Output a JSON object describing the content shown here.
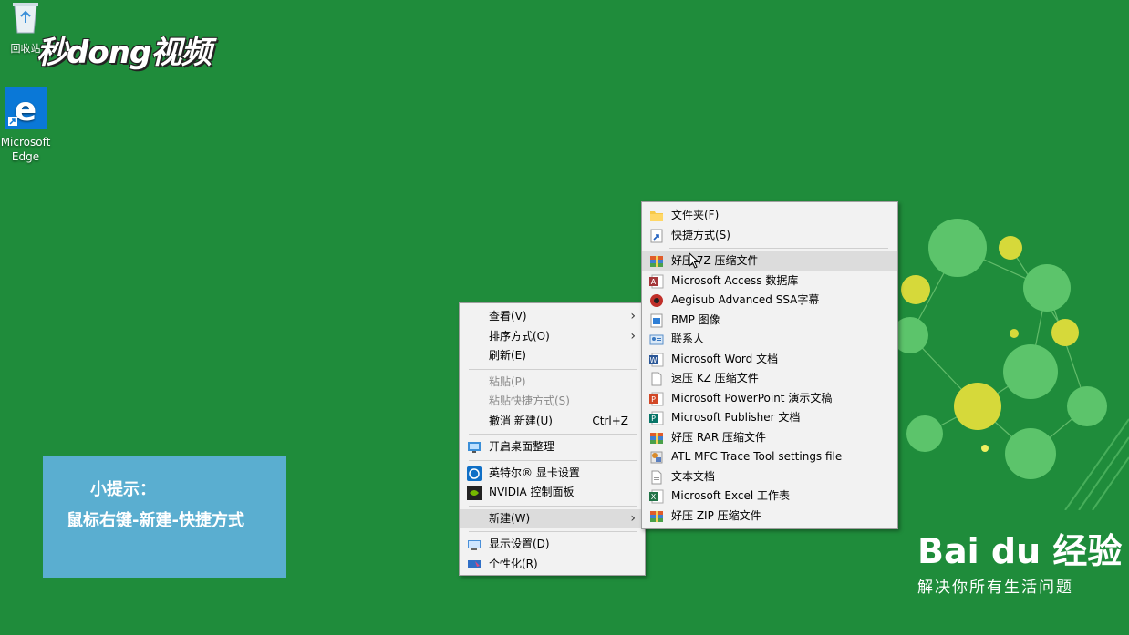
{
  "desktop": {
    "icons": [
      {
        "label": "回收站",
        "icon": "recycle-bin-icon"
      },
      {
        "label": "Microsoft Edge",
        "icon": "edge-icon"
      }
    ],
    "watermark": "秒dong视频"
  },
  "tip": {
    "title": "小提示：",
    "text": "鼠标右键-新建-快捷方式"
  },
  "baidu": {
    "brand": "Bai du 经验",
    "slogan": "解决你所有生活问题"
  },
  "context_menu": {
    "items": [
      {
        "label": "查看(V)",
        "submenu": true
      },
      {
        "label": "排序方式(O)",
        "submenu": true
      },
      {
        "label": "刷新(E)"
      },
      {
        "label": "粘贴(P)",
        "disabled": true
      },
      {
        "label": "粘贴快捷方式(S)",
        "disabled": true
      },
      {
        "label": "撤消 新建(U)",
        "shortcut": "Ctrl+Z"
      },
      {
        "label": "开启桌面整理",
        "icon": "desktop-organize-icon"
      },
      {
        "label": "英特尔® 显卡设置",
        "icon": "intel-graphics-icon"
      },
      {
        "label": "NVIDIA 控制面板",
        "icon": "nvidia-icon"
      },
      {
        "label": "新建(W)",
        "submenu": true,
        "highlighted": true
      },
      {
        "label": "显示设置(D)",
        "icon": "display-icon"
      },
      {
        "label": "个性化(R)",
        "icon": "personalize-icon"
      }
    ]
  },
  "new_submenu": {
    "items": [
      {
        "label": "文件夹(F)",
        "icon": "folder-icon"
      },
      {
        "label": "快捷方式(S)",
        "icon": "shortcut-icon"
      },
      {
        "label": "好压 7Z 压缩文件",
        "icon": "archive-icon",
        "highlighted": true
      },
      {
        "label": "Microsoft Access 数据库",
        "icon": "access-icon"
      },
      {
        "label": "Aegisub Advanced SSA字幕",
        "icon": "aegisub-icon"
      },
      {
        "label": "BMP 图像",
        "icon": "bmp-icon"
      },
      {
        "label": "联系人",
        "icon": "contact-icon"
      },
      {
        "label": "Microsoft Word 文档",
        "icon": "word-icon"
      },
      {
        "label": "速压 KZ 压缩文件",
        "icon": "blank-file-icon"
      },
      {
        "label": "Microsoft PowerPoint 演示文稿",
        "icon": "powerpoint-icon"
      },
      {
        "label": "Microsoft Publisher 文档",
        "icon": "publisher-icon"
      },
      {
        "label": "好压 RAR 压缩文件",
        "icon": "archive-icon"
      },
      {
        "label": "ATL MFC Trace Tool settings file",
        "icon": "atl-icon"
      },
      {
        "label": "文本文档",
        "icon": "text-file-icon"
      },
      {
        "label": "Microsoft Excel 工作表",
        "icon": "excel-icon"
      },
      {
        "label": "好压 ZIP 压缩文件",
        "icon": "archive-icon"
      }
    ]
  },
  "colors": {
    "desktop": "#1f8c3b",
    "tip": "#5aaed0",
    "menu": "#f2f2f2",
    "highlight": "#dcdcdc"
  }
}
